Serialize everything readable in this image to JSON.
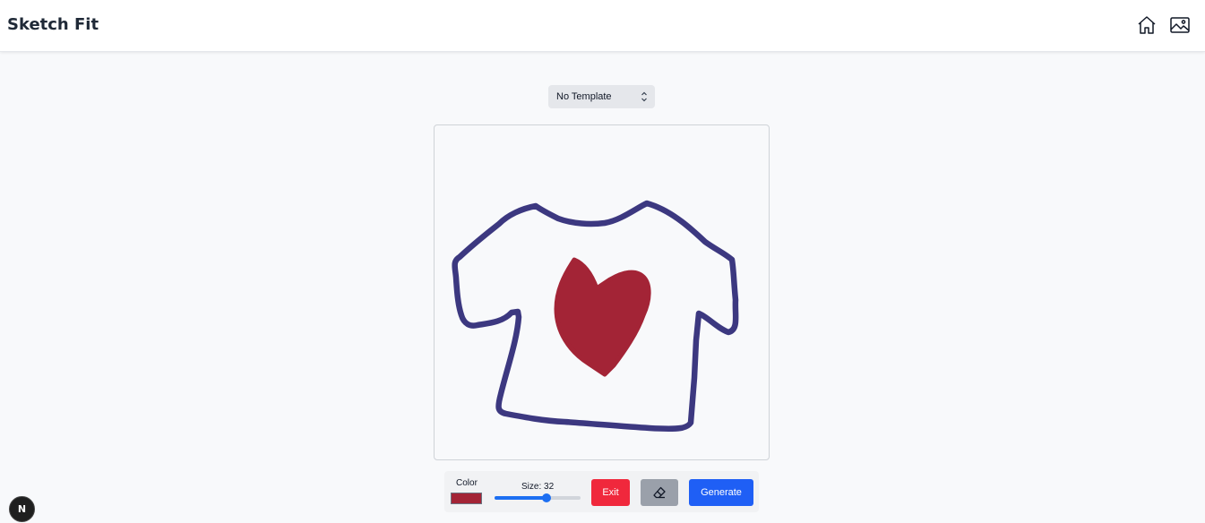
{
  "header": {
    "title": "Sketch Fit",
    "icons": [
      "home-icon",
      "gallery-icon"
    ]
  },
  "template": {
    "selected": "No Template"
  },
  "canvas": {
    "outline_color": "#3c3880",
    "fill_color": "#a32436"
  },
  "toolbar": {
    "color_label": "Color",
    "current_color": "#a32436",
    "size_label": "Size: 32",
    "size_value": 32,
    "size_fraction": 0.6,
    "exit_label": "Exit",
    "eraser_icon": "eraser-icon",
    "generate_label": "Generate"
  },
  "badge": {
    "text": "N"
  },
  "colors": {
    "exit": "#f0283c",
    "generate": "#1f5ff5",
    "eraser": "#9aa0aa",
    "slider": "#1d6ff2"
  }
}
